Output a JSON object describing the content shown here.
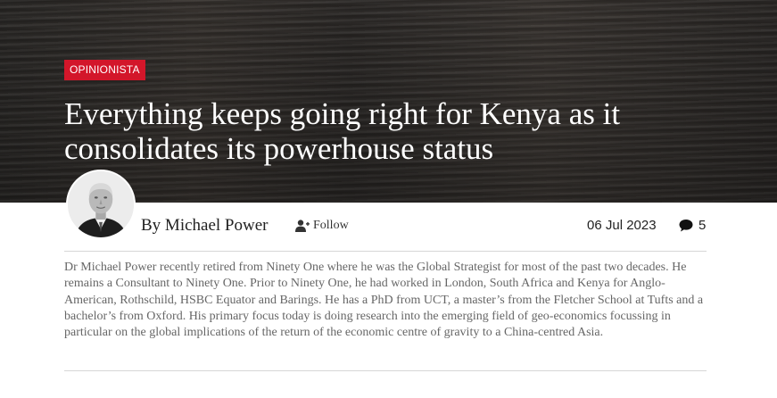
{
  "article": {
    "category": "OPINIONISTA",
    "headline": "Everything keeps going right for Kenya as it consolidates its powerhouse status",
    "author": "By Michael Power",
    "follow_label": "Follow",
    "date": "06 Jul 2023",
    "comment_count": "5",
    "bio": "Dr Michael Power recently retired from Ninety One where he was the Global Strategist for most of the past two decades. He remains a Consultant to Ninety One. Prior to Ninety One, he had worked in London, South Africa and Kenya for Anglo-American, Rothschild, HSBC Equator and Barings. He has a PhD from UCT, a master’s from the Fletcher School at Tufts and a bachelor’s from Oxford. His primary focus today is doing research into the emerging field of geo-economics focussing in particular on the global implications of the return of the economic centre of gravity to a China-centred Asia."
  },
  "colors": {
    "accent": "#d3162a",
    "hero_background": "#2a2826",
    "bio_text": "#666666"
  },
  "icons": {
    "follow": "user-plus-icon",
    "comments": "comment-bubble-icon"
  }
}
